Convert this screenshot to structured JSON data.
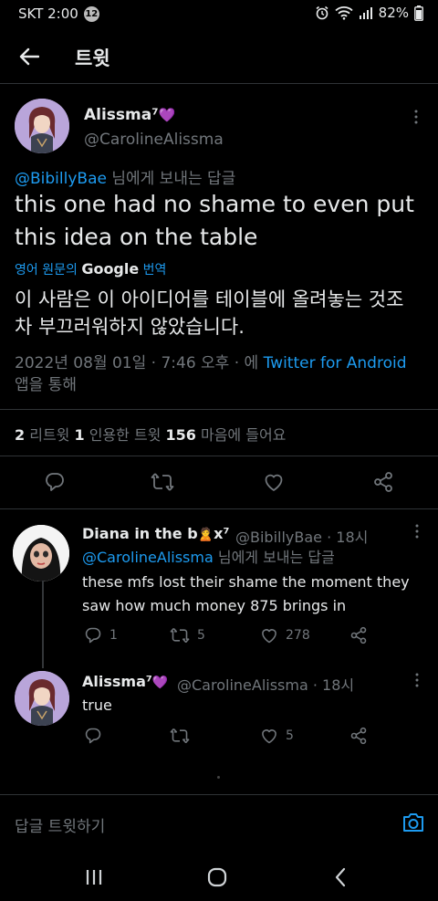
{
  "status_bar": {
    "carrier_time": "SKT 2:00",
    "notification_count": "12",
    "battery": "82%",
    "icons": [
      "alarm-icon",
      "wifi-icon",
      "signal-icon",
      "battery-icon"
    ]
  },
  "header": {
    "title": "트윗"
  },
  "main_tweet": {
    "name": "Alissma⁷",
    "heart_emoji": "💜",
    "handle": "@CarolineAlissma",
    "reply_to_handle": "@BibillyBae",
    "reply_to_suffix": " 님에게 보내는 답글",
    "text": "this one had no shame to even put this idea on the table",
    "translate_prefix": "영어 원문의 ",
    "translate_google": "Google",
    "translate_suffix": " 번역",
    "translated_text": "이 사람은 이 아이디어를 테이블에 올려놓는 것조차 부끄러워하지 않았습니다.",
    "date": "2022년 08월 01일 · 7:46 오후 · 에 ",
    "source": "Twitter for Android",
    "source_suffix": "앱을 통해",
    "stats": {
      "retweets_count": "2",
      "retweets_label": " 리트윗  ",
      "quotes_count": "1",
      "quotes_label": " 인용한 트윗  ",
      "likes_count": "156",
      "likes_label": " 마음에 들어요"
    }
  },
  "replies": [
    {
      "name": "Diana in the b",
      "name_emoji": "🙎",
      "name_suffix": "x⁷",
      "handle_time": "@BibillyBae · 18시",
      "reply_to_handle": "@CarolineAlissma",
      "reply_to_suffix": " 님에게 보내는 답글",
      "text": "these mfs lost their shame the moment they saw how much money 875 brings in",
      "reply_count": "1",
      "retweet_count": "5",
      "like_count": "278"
    },
    {
      "name": "Alissma⁷",
      "name_emoji": "💜",
      "handle_time": "@CarolineAlissma · 18시",
      "text": "true",
      "reply_count": "",
      "retweet_count": "",
      "like_count": "5"
    }
  ],
  "composer": {
    "placeholder": "답글 트윗하기"
  },
  "colors": {
    "accent": "#1d9bf0",
    "background": "#000000",
    "secondary_text": "#71767b",
    "divider": "#2f3336"
  }
}
